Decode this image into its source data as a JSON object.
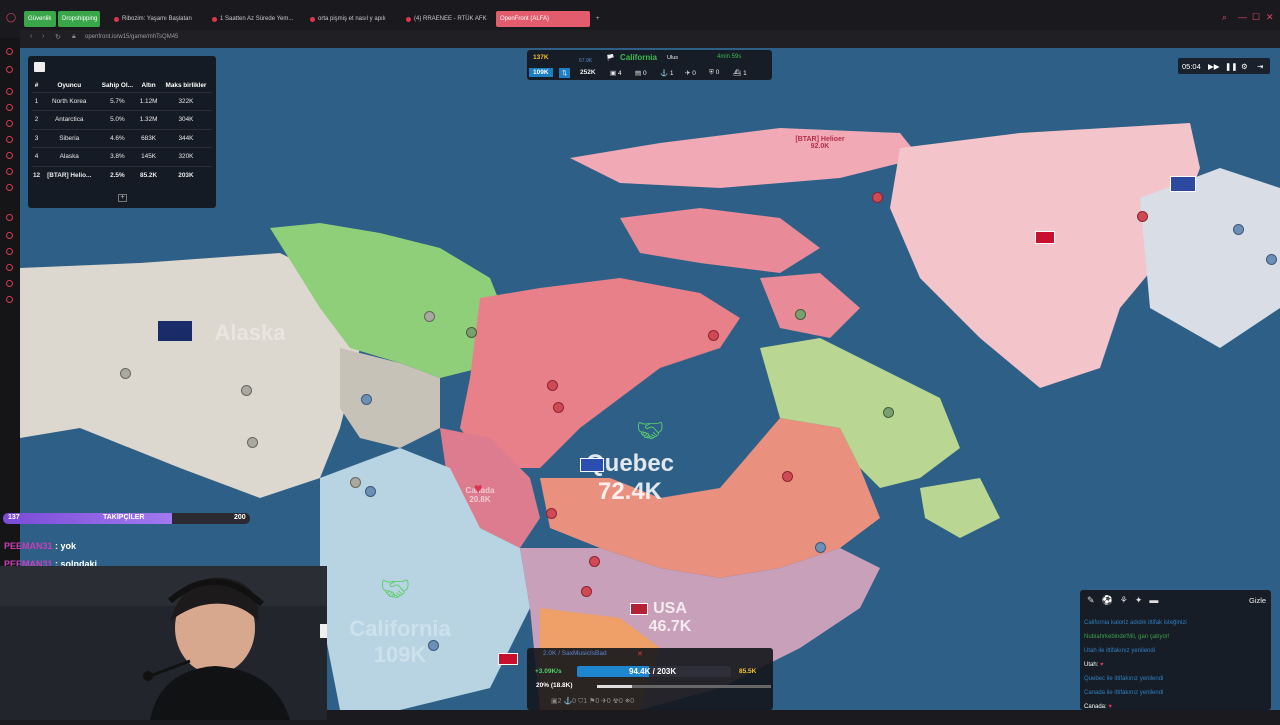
{
  "browser": {
    "tabs": [
      {
        "label": "Güvenlik",
        "style": "green"
      },
      {
        "label": "Dropshipping",
        "style": "green"
      },
      {
        "label": "Ribozim: Yaşamı Başlatan",
        "style": "plain"
      },
      {
        "label": "1 Saatten Az Sürede Yem...",
        "style": "plain"
      },
      {
        "label": "orta pişmiş et nasıl y apılı",
        "style": "plain"
      },
      {
        "label": "(4) RRAENEE - RTÜK AFK",
        "style": "plain"
      },
      {
        "label": "OpenFront (ALFA)",
        "style": "active"
      }
    ],
    "new_tab": "+",
    "url": "openfront.io/w15/game/mhTsQM45"
  },
  "leaderboard": {
    "headers": [
      "#",
      "Oyuncu",
      "Sahip Ol...",
      "Altın",
      "Maks birlikler"
    ],
    "rows": [
      [
        "1",
        "North Korea",
        "5.7%",
        "1.12M",
        "322K"
      ],
      [
        "2",
        "Antarctica",
        "5.0%",
        "1.32M",
        "304K"
      ],
      [
        "3",
        "Siberia",
        "4.6%",
        "683K",
        "344K"
      ],
      [
        "4",
        "Alaska",
        "3.8%",
        "145K",
        "320K"
      ],
      [
        "12",
        "[BTAR] Helio...",
        "2.5%",
        "85.2K",
        "203K"
      ]
    ],
    "expand": "+"
  },
  "top_stats": {
    "gold": "137K",
    "sub_value": "67.9K",
    "player": "California",
    "player_sub": "Ulus",
    "status": "4min 59s",
    "troops": "109K",
    "workers": "252K",
    "counts": [
      "4",
      "0",
      "1",
      "0",
      "0",
      "1"
    ]
  },
  "timer": {
    "time": "05:04",
    "ff": "▶▶",
    "pause": "❚❚",
    "settings": "⚙",
    "exit": "⇥"
  },
  "map_labels": {
    "quebec": "Quebec",
    "quebec_troops": "72.4K",
    "usa": "USA",
    "usa_troops": "46.7K",
    "helioer": "[BTAR] Helioer",
    "helioer_troops": "92.0K",
    "canada": "Canada",
    "canada_troops": "20.8K",
    "alaska": "Alaska",
    "california": "California",
    "california_troops": "109K"
  },
  "followers": {
    "current": "137",
    "label": "TAKİPÇİLER",
    "goal": "200",
    "progress": 0.685
  },
  "chat": [
    {
      "user": "PEEMAN31",
      "msg": " : yok"
    },
    {
      "user": "PEEMAN31",
      "msg": " : solndaki"
    }
  ],
  "bottom_panel": {
    "name": "2.0K / SaxMusicIsBad",
    "close": "✕",
    "rate": "+3.09K/s",
    "troops": "94.4K / 203K",
    "troop_ratio": 0.465,
    "gold": "85.5K",
    "attack": "20% (18.8K)",
    "attack_ratio": 0.2,
    "icons": "▣2  ⚓0  ⛉1  ⚑0  ✈0  ☢0  ⛯0"
  },
  "events": {
    "hide": "Gizle",
    "lines": [
      {
        "text": "California kaloriz adıdık ittifak isteğinizi",
        "style": "dim"
      },
      {
        "text": "Nubiahrkebinde'Mil, gan çatıyor!",
        "style": "dimg"
      },
      {
        "text": "Utah ile ittifakınız yenilendi",
        "style": "dim"
      },
      {
        "text": "Utah: ",
        "style": "w",
        "heart": "♥"
      },
      {
        "text": "Quebec ile ittifakınız yenilendi",
        "style": "dim"
      },
      {
        "text": "Canada ile ittifakınız yenilendi",
        "style": "dim"
      },
      {
        "text": "Canada: ",
        "style": "w",
        "heart": "♥"
      }
    ]
  },
  "colors": {
    "ocean": "#2e5f86",
    "accent": "#e25c6e",
    "quebec": "#e58a8a",
    "helioer": "#f0a6b3"
  }
}
